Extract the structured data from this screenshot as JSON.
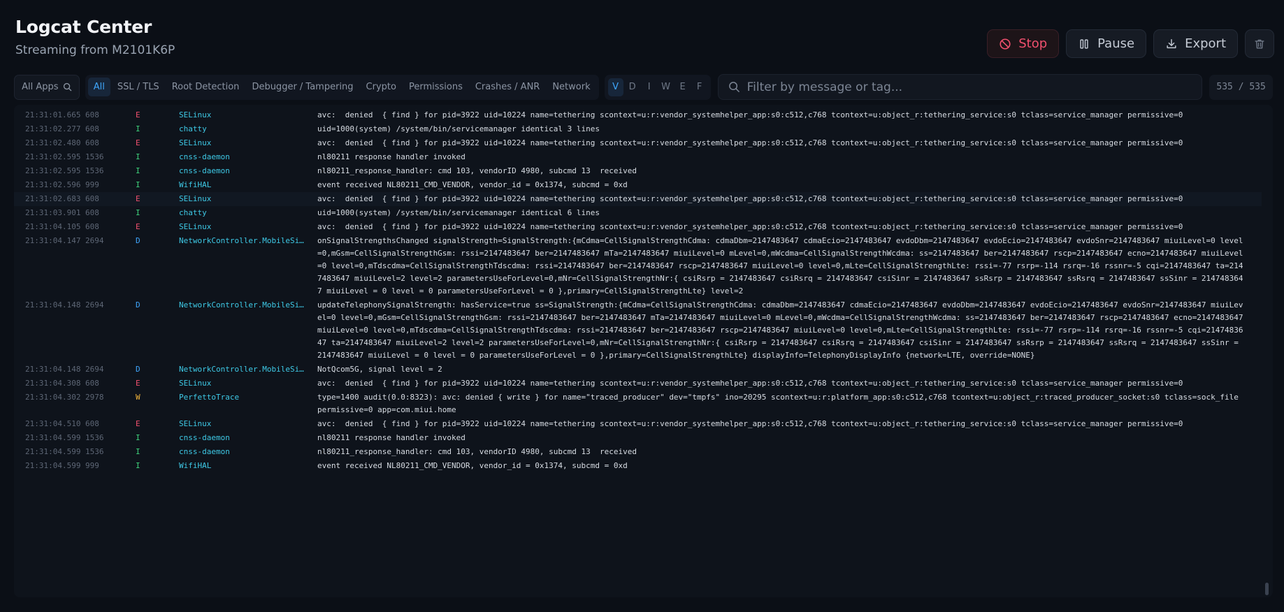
{
  "header": {
    "title": "Logcat Center",
    "subtitle": "Streaming from M2101K6P",
    "stop_label": "Stop",
    "pause_label": "Pause",
    "export_label": "Export"
  },
  "toolbar": {
    "app_filter": "All Apps",
    "categories": [
      "All",
      "SSL / TLS",
      "Root Detection",
      "Debugger / Tampering",
      "Crypto",
      "Permissions",
      "Crashes / ANR",
      "Network"
    ],
    "levels": [
      "V",
      "D",
      "I",
      "W",
      "E",
      "F"
    ],
    "filter_placeholder": "Filter by message or tag...",
    "count": "535 / 535"
  },
  "logs": [
    {
      "time": "21:31:01.665",
      "pid": "608",
      "level": "E",
      "tag": "SELinux",
      "msg": "avc:  denied  { find } for pid=3922 uid=10224 name=tethering scontext=u:r:vendor_systemhelper_app:s0:c512,c768 tcontext=u:object_r:tethering_service:s0 tclass=service_manager permissive=0"
    },
    {
      "time": "21:31:02.277",
      "pid": "608",
      "level": "I",
      "tag": "chatty",
      "msg": "uid=1000(system) /system/bin/servicemanager identical 3 lines"
    },
    {
      "time": "21:31:02.480",
      "pid": "608",
      "level": "E",
      "tag": "SELinux",
      "msg": "avc:  denied  { find } for pid=3922 uid=10224 name=tethering scontext=u:r:vendor_systemhelper_app:s0:c512,c768 tcontext=u:object_r:tethering_service:s0 tclass=service_manager permissive=0"
    },
    {
      "time": "21:31:02.595",
      "pid": "1536",
      "level": "I",
      "tag": "cnss-daemon",
      "msg": "nl80211 response handler invoked"
    },
    {
      "time": "21:31:02.595",
      "pid": "1536",
      "level": "I",
      "tag": "cnss-daemon",
      "msg": "nl80211_response_handler: cmd 103, vendorID 4980, subcmd 13  received"
    },
    {
      "time": "21:31:02.596",
      "pid": "999",
      "level": "I",
      "tag": "WifiHAL",
      "msg": "event received NL80211_CMD_VENDOR, vendor_id = 0x1374, subcmd = 0xd"
    },
    {
      "time": "21:31:02.683",
      "pid": "608",
      "level": "E",
      "tag": "SELinux",
      "msg": "avc:  denied  { find } for pid=3922 uid=10224 name=tethering scontext=u:r:vendor_systemhelper_app:s0:c512,c768 tcontext=u:object_r:tethering_service:s0 tclass=service_manager permissive=0"
    },
    {
      "time": "21:31:03.901",
      "pid": "608",
      "level": "I",
      "tag": "chatty",
      "msg": "uid=1000(system) /system/bin/servicemanager identical 6 lines"
    },
    {
      "time": "21:31:04.105",
      "pid": "608",
      "level": "E",
      "tag": "SELinux",
      "msg": "avc:  denied  { find } for pid=3922 uid=10224 name=tethering scontext=u:r:vendor_systemhelper_app:s0:c512,c768 tcontext=u:object_r:tethering_service:s0 tclass=service_manager permissive=0"
    },
    {
      "time": "21:31:04.147",
      "pid": "2694",
      "level": "D",
      "tag": "NetworkController.MobileSi…",
      "msg": "onSignalStrengthsChanged signalStrength=SignalStrength:{mCdma=CellSignalStrengthCdma: cdmaDbm=2147483647 cdmaEcio=2147483647 evdoDbm=2147483647 evdoEcio=2147483647 evdoSnr=2147483647 miuiLevel=0 level=0,mGsm=CellSignalStrengthGsm: rssi=2147483647 ber=2147483647 mTa=2147483647 miuiLevel=0 mLevel=0,mWcdma=CellSignalStrengthWcdma: ss=2147483647 ber=2147483647 rscp=2147483647 ecno=2147483647 miuiLevel=0 level=0,mTdscdma=CellSignalStrengthTdscdma: rssi=2147483647 ber=2147483647 rscp=2147483647 miuiLevel=0 level=0,mLte=CellSignalStrengthLte: rssi=-77 rsrp=-114 rsrq=-16 rssnr=-5 cqi=2147483647 ta=2147483647 miuiLevel=2 level=2 parametersUseForLevel=0,mNr=CellSignalStrengthNr:{ csiRsrp = 2147483647 csiRsrq = 2147483647 csiSinr = 2147483647 ssRsrp = 2147483647 ssRsrq = 2147483647 ssSinr = 2147483647 miuiLevel = 0 level = 0 parametersUseForLevel = 0 },primary=CellSignalStrengthLte} level=2"
    },
    {
      "time": "21:31:04.148",
      "pid": "2694",
      "level": "D",
      "tag": "NetworkController.MobileSi…",
      "msg": "updateTelephonySignalStrength: hasService=true ss=SignalStrength:{mCdma=CellSignalStrengthCdma: cdmaDbm=2147483647 cdmaEcio=2147483647 evdoDbm=2147483647 evdoEcio=2147483647 evdoSnr=2147483647 miuiLevel=0 level=0,mGsm=CellSignalStrengthGsm: rssi=2147483647 ber=2147483647 mTa=2147483647 miuiLevel=0 mLevel=0,mWcdma=CellSignalStrengthWcdma: ss=2147483647 ber=2147483647 rscp=2147483647 ecno=2147483647 miuiLevel=0 level=0,mTdscdma=CellSignalStrengthTdscdma: rssi=2147483647 ber=2147483647 rscp=2147483647 miuiLevel=0 level=0,mLte=CellSignalStrengthLte: rssi=-77 rsrp=-114 rsrq=-16 rssnr=-5 cqi=2147483647 ta=2147483647 miuiLevel=2 level=2 parametersUseForLevel=0,mNr=CellSignalStrengthNr:{ csiRsrp = 2147483647 csiRsrq = 2147483647 csiSinr = 2147483647 ssRsrp = 2147483647 ssRsrq = 2147483647 ssSinr = 2147483647 miuiLevel = 0 level = 0 parametersUseForLevel = 0 },primary=CellSignalStrengthLte} displayInfo=TelephonyDisplayInfo {network=LTE, override=NONE}"
    },
    {
      "time": "21:31:04.148",
      "pid": "2694",
      "level": "D",
      "tag": "NetworkController.MobileSi…",
      "msg": "NotQcom5G, signal level = 2"
    },
    {
      "time": "21:31:04.308",
      "pid": "608",
      "level": "E",
      "tag": "SELinux",
      "msg": "avc:  denied  { find } for pid=3922 uid=10224 name=tethering scontext=u:r:vendor_systemhelper_app:s0:c512,c768 tcontext=u:object_r:tethering_service:s0 tclass=service_manager permissive=0"
    },
    {
      "time": "21:31:04.302",
      "pid": "2978",
      "level": "W",
      "tag": "PerfettoTrace",
      "msg": "type=1400 audit(0.0:8323): avc: denied { write } for name=\"traced_producer\" dev=\"tmpfs\" ino=20295 scontext=u:r:platform_app:s0:c512,c768 tcontext=u:object_r:traced_producer_socket:s0 tclass=sock_file permissive=0 app=com.miui.home"
    },
    {
      "time": "21:31:04.510",
      "pid": "608",
      "level": "E",
      "tag": "SELinux",
      "msg": "avc:  denied  { find } for pid=3922 uid=10224 name=tethering scontext=u:r:vendor_systemhelper_app:s0:c512,c768 tcontext=u:object_r:tethering_service:s0 tclass=service_manager permissive=0"
    },
    {
      "time": "21:31:04.599",
      "pid": "1536",
      "level": "I",
      "tag": "cnss-daemon",
      "msg": "nl80211 response handler invoked"
    },
    {
      "time": "21:31:04.599",
      "pid": "1536",
      "level": "I",
      "tag": "cnss-daemon",
      "msg": "nl80211_response_handler: cmd 103, vendorID 4980, subcmd 13  received"
    },
    {
      "time": "21:31:04.599",
      "pid": "999",
      "level": "I",
      "tag": "WifiHAL",
      "msg": "event received NL80211_CMD_VENDOR, vendor_id = 0x1374, subcmd = 0xd"
    }
  ]
}
